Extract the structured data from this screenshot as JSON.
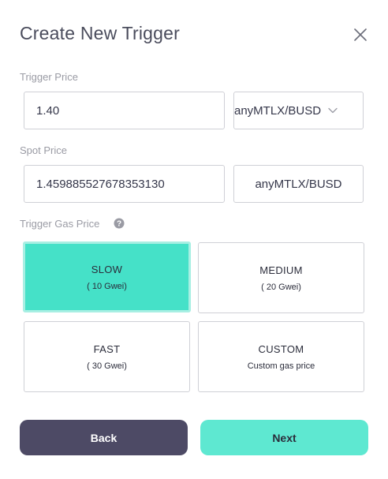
{
  "dialog": {
    "title": "Create New Trigger"
  },
  "trigger_price": {
    "label": "Trigger Price",
    "value": "1.40",
    "pair": "anyMTLX/BUSD"
  },
  "spot_price": {
    "label": "Spot Price",
    "value": "1.459885527678353130",
    "pair": "anyMTLX/BUSD"
  },
  "gas": {
    "label": "Trigger Gas Price",
    "options": [
      {
        "name": "SLOW",
        "detail": "( 10 Gwei)",
        "selected": true
      },
      {
        "name": "MEDIUM",
        "detail": "( 20 Gwei)",
        "selected": false
      },
      {
        "name": "FAST",
        "detail": "( 30 Gwei)",
        "selected": false
      },
      {
        "name": "CUSTOM",
        "detail": "Custom gas price",
        "selected": false
      }
    ]
  },
  "actions": {
    "back_label": "Back",
    "next_label": "Next"
  },
  "colors": {
    "accent": "#45e1c8",
    "next_button": "#5ee8d1",
    "back_button": "#4d4a65"
  },
  "icons": {
    "close": "close-icon",
    "help": "help-icon",
    "dropdown": "chevron-down-icon"
  }
}
